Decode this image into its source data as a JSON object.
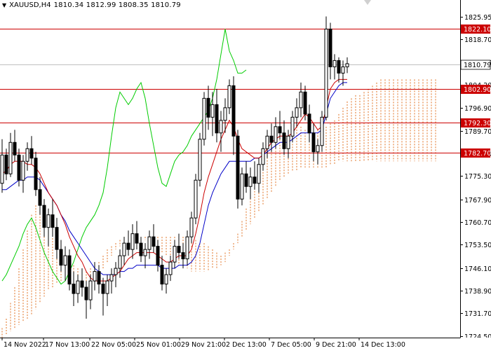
{
  "header": {
    "symbol": "XAUUSD,H4",
    "open": "1810.34",
    "high": "1812.99",
    "low": "1808.35",
    "close": "1810.79"
  },
  "chart_data": {
    "type": "candlestick",
    "symbol": "XAUUSD",
    "timeframe": "H4",
    "ylim": [
      1724.0,
      1829.0
    ],
    "y_ticks": [
      "1825.95",
      "1818.70",
      "1811.45",
      "1804.20",
      "1796.90",
      "1789.70",
      "1782.40",
      "1775.30",
      "1767.90",
      "1760.70",
      "1753.50",
      "1746.10",
      "1738.90",
      "1731.70",
      "1724.50"
    ],
    "x_ticks": [
      "14 Nov 2022",
      "17 Nov 13:00",
      "22 Nov 05:00",
      "25 Nov 01:00",
      "29 Nov 21:00",
      "2 Dec 13:00",
      "7 Dec 05:00",
      "9 Dec 21:00",
      "14 Dec 13:00"
    ],
    "levels": [
      {
        "label": "1822.10",
        "value": 1822.1,
        "color": "#cc0000"
      },
      {
        "label": "1810.79",
        "value": 1810.79,
        "color": "#c0c0c0",
        "current": true
      },
      {
        "label": "1802.90",
        "value": 1802.9,
        "color": "#cc0000"
      },
      {
        "label": "1792.30",
        "value": 1792.3,
        "color": "#cc0000"
      },
      {
        "label": "1782.70",
        "value": 1782.7,
        "color": "#cc0000"
      }
    ],
    "candles": [
      [
        1773,
        1787,
        1770,
        1782
      ],
      [
        1782,
        1784,
        1774,
        1776
      ],
      [
        1776,
        1789,
        1775,
        1786
      ],
      [
        1786,
        1790,
        1780,
        1782
      ],
      [
        1782,
        1784,
        1772,
        1774
      ],
      [
        1774,
        1782,
        1770,
        1780
      ],
      [
        1780,
        1786,
        1777,
        1784
      ],
      [
        1784,
        1788,
        1779,
        1781
      ],
      [
        1781,
        1783,
        1769,
        1771
      ],
      [
        1771,
        1775,
        1763,
        1766
      ],
      [
        1766,
        1768,
        1756,
        1759
      ],
      [
        1759,
        1765,
        1753,
        1763
      ],
      [
        1763,
        1768,
        1756,
        1759
      ],
      [
        1759,
        1762,
        1749,
        1752
      ],
      [
        1752,
        1755,
        1745,
        1747
      ],
      [
        1747,
        1753,
        1742,
        1750
      ],
      [
        1750,
        1752,
        1739,
        1741
      ],
      [
        1741,
        1745,
        1734,
        1738
      ],
      [
        1738,
        1744,
        1735,
        1742
      ],
      [
        1742,
        1746,
        1737,
        1740
      ],
      [
        1740,
        1742,
        1730,
        1736
      ],
      [
        1736,
        1744,
        1733,
        1742
      ],
      [
        1742,
        1748,
        1739,
        1745
      ],
      [
        1745,
        1747,
        1738,
        1741
      ],
      [
        1741,
        1743,
        1731,
        1738
      ],
      [
        1738,
        1744,
        1734,
        1742
      ],
      [
        1742,
        1746,
        1738,
        1744
      ],
      [
        1744,
        1748,
        1740,
        1746
      ],
      [
        1746,
        1752,
        1743,
        1750
      ],
      [
        1750,
        1756,
        1747,
        1754
      ],
      [
        1754,
        1758,
        1750,
        1752
      ],
      [
        1752,
        1760,
        1749,
        1757
      ],
      [
        1757,
        1761,
        1752,
        1754
      ],
      [
        1754,
        1756,
        1748,
        1750
      ],
      [
        1750,
        1754,
        1746,
        1752
      ],
      [
        1752,
        1758,
        1749,
        1756
      ],
      [
        1756,
        1760,
        1751,
        1753
      ],
      [
        1753,
        1755,
        1745,
        1747
      ],
      [
        1747,
        1750,
        1739,
        1741
      ],
      [
        1741,
        1746,
        1738,
        1744
      ],
      [
        1744,
        1750,
        1742,
        1748
      ],
      [
        1748,
        1755,
        1746,
        1753
      ],
      [
        1753,
        1757,
        1749,
        1751
      ],
      [
        1751,
        1754,
        1746,
        1749
      ],
      [
        1749,
        1758,
        1747,
        1756
      ],
      [
        1756,
        1764,
        1754,
        1762
      ],
      [
        1762,
        1776,
        1760,
        1774
      ],
      [
        1774,
        1789,
        1772,
        1787
      ],
      [
        1787,
        1802,
        1785,
        1800
      ],
      [
        1800,
        1804,
        1790,
        1794
      ],
      [
        1794,
        1802,
        1788,
        1798
      ],
      [
        1798,
        1803,
        1786,
        1789
      ],
      [
        1789,
        1796,
        1783,
        1793
      ],
      [
        1793,
        1800,
        1789,
        1797
      ],
      [
        1797,
        1806,
        1795,
        1804
      ],
      [
        1804,
        1807,
        1782,
        1788
      ],
      [
        1788,
        1790,
        1765,
        1768
      ],
      [
        1768,
        1778,
        1766,
        1776
      ],
      [
        1776,
        1780,
        1770,
        1772
      ],
      [
        1772,
        1778,
        1768,
        1775
      ],
      [
        1775,
        1780,
        1771,
        1773
      ],
      [
        1773,
        1781,
        1770,
        1779
      ],
      [
        1779,
        1786,
        1777,
        1784
      ],
      [
        1784,
        1790,
        1781,
        1788
      ],
      [
        1788,
        1792,
        1783,
        1786
      ],
      [
        1786,
        1794,
        1784,
        1791
      ],
      [
        1791,
        1796,
        1787,
        1789
      ],
      [
        1789,
        1793,
        1782,
        1784
      ],
      [
        1784,
        1790,
        1781,
        1788
      ],
      [
        1788,
        1796,
        1786,
        1794
      ],
      [
        1794,
        1800,
        1791,
        1797
      ],
      [
        1797,
        1805,
        1794,
        1802
      ],
      [
        1802,
        1804,
        1793,
        1795
      ],
      [
        1795,
        1798,
        1786,
        1789
      ],
      [
        1789,
        1792,
        1780,
        1783
      ],
      [
        1783,
        1787,
        1779,
        1785
      ],
      [
        1785,
        1796,
        1783,
        1794
      ],
      [
        1794,
        1826,
        1793,
        1822
      ],
      [
        1822,
        1824,
        1806,
        1810
      ],
      [
        1810,
        1814,
        1806,
        1812
      ],
      [
        1812,
        1813,
        1805,
        1808
      ],
      [
        1808,
        1812,
        1804,
        1810
      ],
      [
        1810,
        1813,
        1808,
        1811
      ]
    ],
    "tenkan_sen": [
      1776,
      1777,
      1779,
      1780,
      1780,
      1780,
      1779,
      1779,
      1778,
      1776,
      1773,
      1770,
      1768,
      1766,
      1763,
      1760,
      1756,
      1753,
      1750,
      1748,
      1745,
      1743,
      1742,
      1742,
      1742,
      1742,
      1743,
      1744,
      1745,
      1747,
      1749,
      1750,
      1751,
      1751,
      1751,
      1751,
      1751,
      1750,
      1749,
      1748,
      1748,
      1749,
      1750,
      1750,
      1750,
      1752,
      1757,
      1763,
      1770,
      1775,
      1779,
      1783,
      1787,
      1790,
      1793,
      1791,
      1787,
      1784,
      1783,
      1782,
      1781,
      1781,
      1782,
      1784,
      1786,
      1787,
      1788,
      1788,
      1788,
      1789,
      1791,
      1793,
      1795,
      1794,
      1792,
      1790,
      1791,
      1797,
      1803,
      1805,
      1806,
      1806,
      1806
    ],
    "kijun_sen": [
      1771,
      1771,
      1772,
      1773,
      1774,
      1774,
      1775,
      1775,
      1775,
      1774,
      1772,
      1770,
      1768,
      1766,
      1763,
      1761,
      1758,
      1756,
      1754,
      1752,
      1750,
      1748,
      1746,
      1745,
      1744,
      1744,
      1744,
      1744,
      1745,
      1745,
      1746,
      1746,
      1747,
      1747,
      1747,
      1747,
      1747,
      1747,
      1746,
      1746,
      1746,
      1746,
      1747,
      1747,
      1747,
      1748,
      1750,
      1754,
      1760,
      1766,
      1770,
      1773,
      1776,
      1778,
      1780,
      1780,
      1780,
      1780,
      1780,
      1780,
      1781,
      1781,
      1782,
      1783,
      1784,
      1785,
      1786,
      1786,
      1786,
      1787,
      1788,
      1789,
      1789,
      1789,
      1789,
      1789,
      1790,
      1795,
      1800,
      1802,
      1804,
      1805,
      1805
    ],
    "chikou_span": [
      1742,
      1744,
      1747,
      1750,
      1753,
      1757,
      1760,
      1762,
      1759,
      1755,
      1751,
      1748,
      1745,
      1743,
      1741,
      1742,
      1745,
      1748,
      1752,
      1756,
      1759,
      1761,
      1763,
      1766,
      1770,
      1778,
      1788,
      1797,
      1802,
      1800,
      1798,
      1800,
      1803,
      1805,
      1800,
      1792,
      1785,
      1778,
      1773,
      1772,
      1776,
      1780,
      1782,
      1783,
      1785,
      1788,
      1790,
      1792,
      1794,
      1796,
      1800,
      1806,
      1814,
      1822,
      1815,
      1812,
      1808,
      1808,
      1809
    ],
    "cloud_top": [
      1727,
      1730,
      1735,
      1740,
      1746,
      1752,
      1758,
      1763,
      1766,
      1766,
      1765,
      1763,
      1760,
      1757,
      1754,
      1751,
      1749,
      1747,
      1746,
      1745,
      1745,
      1746,
      1747,
      1748,
      1750,
      1752,
      1753,
      1754,
      1755,
      1756,
      1756,
      1756,
      1756,
      1756,
      1756,
      1756,
      1756,
      1756,
      1756,
      1756,
      1756,
      1756,
      1756,
      1756,
      1756,
      1755,
      1755,
      1754,
      1754,
      1753,
      1752,
      1751,
      1750,
      1751,
      1752,
      1754,
      1757,
      1761,
      1765,
      1770,
      1775,
      1778,
      1781,
      1783,
      1785,
      1786,
      1787,
      1788,
      1789,
      1790,
      1791,
      1791,
      1790,
      1790,
      1790,
      1790,
      1790,
      1791,
      1792,
      1793,
      1795,
      1797,
      1799,
      1800,
      1801,
      1801,
      1802,
      1803,
      1804,
      1805,
      1806,
      1806,
      1806,
      1806,
      1806,
      1806,
      1806,
      1806,
      1806,
      1806,
      1806,
      1806,
      1806,
      1806,
      1806,
      1806,
      1806,
      1806,
      1806,
      1806,
      1806,
      1806
    ],
    "cloud_bottom": [
      1724,
      1725,
      1726,
      1727,
      1728,
      1729,
      1730,
      1731,
      1733,
      1735,
      1737,
      1739,
      1740,
      1741,
      1742,
      1742,
      1742,
      1742,
      1742,
      1742,
      1742,
      1742,
      1743,
      1744,
      1746,
      1748,
      1750,
      1752,
      1753,
      1754,
      1754,
      1755,
      1755,
      1755,
      1755,
      1754,
      1753,
      1752,
      1751,
      1750,
      1749,
      1748,
      1747,
      1746,
      1746,
      1745,
      1745,
      1745,
      1745,
      1745,
      1746,
      1746,
      1747,
      1748,
      1750,
      1752,
      1754,
      1756,
      1758,
      1760,
      1762,
      1764,
      1766,
      1768,
      1770,
      1772,
      1774,
      1775,
      1776,
      1777,
      1777,
      1778,
      1778,
      1778,
      1778,
      1778,
      1778,
      1778,
      1779,
      1779,
      1780,
      1780,
      1780,
      1780,
      1780,
      1780,
      1780,
      1780,
      1780,
      1780,
      1780,
      1780,
      1780,
      1780,
      1780,
      1780,
      1780,
      1780,
      1780,
      1780,
      1780,
      1780,
      1780,
      1780,
      1780,
      1780,
      1780,
      1780,
      1780,
      1780,
      1780,
      1780
    ],
    "colors": {
      "bull_candle": "#000000",
      "bear_candle": "#000000",
      "tenkan": "#cc0000",
      "kijun": "#0000c8",
      "chikou": "#00cc00",
      "cloud_bull": "#e07020",
      "cloud_bear": "#9a7ab8",
      "level_line": "#cc0000",
      "level_label_bg": "#cc0000",
      "current_label_bg": "#ffffff"
    }
  }
}
